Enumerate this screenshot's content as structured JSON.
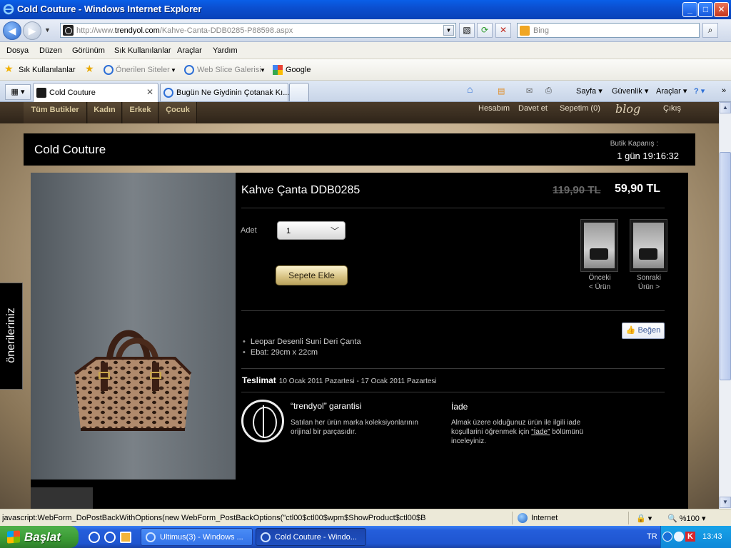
{
  "window": {
    "title": "Cold Couture - Windows Internet Explorer",
    "minimize": "_",
    "maximize": "□",
    "close": "✕"
  },
  "address": {
    "url_prefix": "http://www.",
    "url_domain": "trendyol.com",
    "url_path": "/Kahve-Canta-DDB0285-P88598.aspx",
    "search_placeholder": "Bing"
  },
  "menu": [
    "Dosya",
    "Düzen",
    "Görünüm",
    "Sık Kullanılanlar",
    "Araçlar",
    "Yardım"
  ],
  "favorites": {
    "label": "Sık Kullanılanlar",
    "items": [
      "Önerilen Siteler",
      "Web Slice Galerisi",
      "Google"
    ]
  },
  "tabs": [
    {
      "label": "Cold Couture",
      "active": true
    },
    {
      "label": "Bugün Ne Giydinin Çotanak Kı...",
      "active": false
    }
  ],
  "commands": [
    "Sayfa",
    "Güvenlik",
    "Araçlar"
  ],
  "site": {
    "categories": [
      "Tüm Butikler",
      "Kadın",
      "Erkek",
      "Çocuk"
    ],
    "user_links": [
      "Hesabım",
      "Davet et",
      "Sepetim (0)",
      "Çıkış"
    ],
    "blog_logo": "blog"
  },
  "boutique": {
    "name": "Cold Couture",
    "closing_label": "Butik Kapanış :",
    "closing_time": "1 gün 19:16:32"
  },
  "product": {
    "title": "Kahve Çanta DDB0285",
    "old_price": "119,90 TL",
    "new_price": "59,90 TL",
    "qty_label": "Adet",
    "qty_value": "1",
    "add_to_cart": "Sepete Ekle",
    "prev_label_1": "Önceki",
    "prev_label_2": "< Ürün",
    "next_label_1": "Sonraki",
    "next_label_2": "Ürün >",
    "like": "Beğen",
    "features": [
      "Leopar Desenli Suni Deri Çanta",
      "Ebat: 29cm x 22cm"
    ],
    "delivery_label": "Teslimat",
    "delivery_dates": "10 Ocak 2011 Pazartesi - 17 Ocak 2011 Pazartesi",
    "guarantee_title": "“trendyol” garantisi",
    "guarantee_text": "Satılan her ürün marka koleksiyonlarının orijinal bir parçasıdır.",
    "return_title": "İade",
    "return_text_1": "Almak üzere olduğunuz ürün ile ilgili iade koşullarini öğrenmek için",
    "return_link": "“İade”",
    "return_text_2": "bölümünü inceleyiniz."
  },
  "side_tab": "önerileriniz",
  "status": {
    "text": "javascript:WebForm_DoPostBackWithOptions(new WebForm_PostBackOptions(\"ctl00$ctl00$wpm$ShowProduct$ctl00$B",
    "zone": "Internet",
    "zoom": "%100"
  },
  "taskbar": {
    "start": "Başlat",
    "tasks": [
      {
        "label": "Ultimus(3) - Windows ...",
        "active": false
      },
      {
        "label": "Cold Couture - Windo...",
        "active": true
      }
    ],
    "lang": "TR",
    "clock": "13:43"
  },
  "colors": {
    "accent_gold": "#d6c181",
    "panel_black": "#000000",
    "ie_blue": "#0b4fd0"
  }
}
